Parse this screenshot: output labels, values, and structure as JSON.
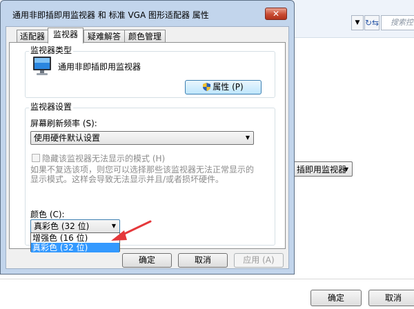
{
  "background_window": {
    "search_placeholder": "搜索控",
    "addr_dropdown_glyph": "▼",
    "refresh_glyph": "↻⇆",
    "monitor_dropdown": "插即用监视器",
    "ok_label": "确定",
    "cancel_label": "取消"
  },
  "dialog": {
    "title": "通用非即插即用监视器 和 标准 VGA 图形适配器 属性",
    "close_glyph": "✕",
    "tabs": [
      "适配器",
      "监视器",
      "疑难解答",
      "颜色管理"
    ],
    "active_tab": "监视器",
    "monitor_type": {
      "group_title": "监视器类型",
      "monitor_name": "通用非即插即用监视器",
      "properties_button": "属性 (P)"
    },
    "monitor_settings": {
      "group_title": "监视器设置",
      "refresh_label": "屏幕刷新频率 (S):",
      "refresh_value": "使用硬件默认设置",
      "hide_modes_label": "隐藏该监视器无法显示的模式 (H)",
      "hide_modes_checked": false,
      "hint_line1": "如果不复选该项，则您可以选择那些该监视器无法正常显示的",
      "hint_line2": "显示模式。这样会导致无法显示并且/或者损坏硬件。",
      "color_label": "颜色 (C):",
      "color_value": "真彩色 (32 位)",
      "color_options": [
        "增强色 (16 位)",
        "真彩色 (32 位)"
      ],
      "color_selected_index": 1
    },
    "buttons": {
      "ok": "确定",
      "cancel": "取消",
      "apply": "应用 (A)"
    },
    "annotation_arrow_color": "#e5383b"
  }
}
